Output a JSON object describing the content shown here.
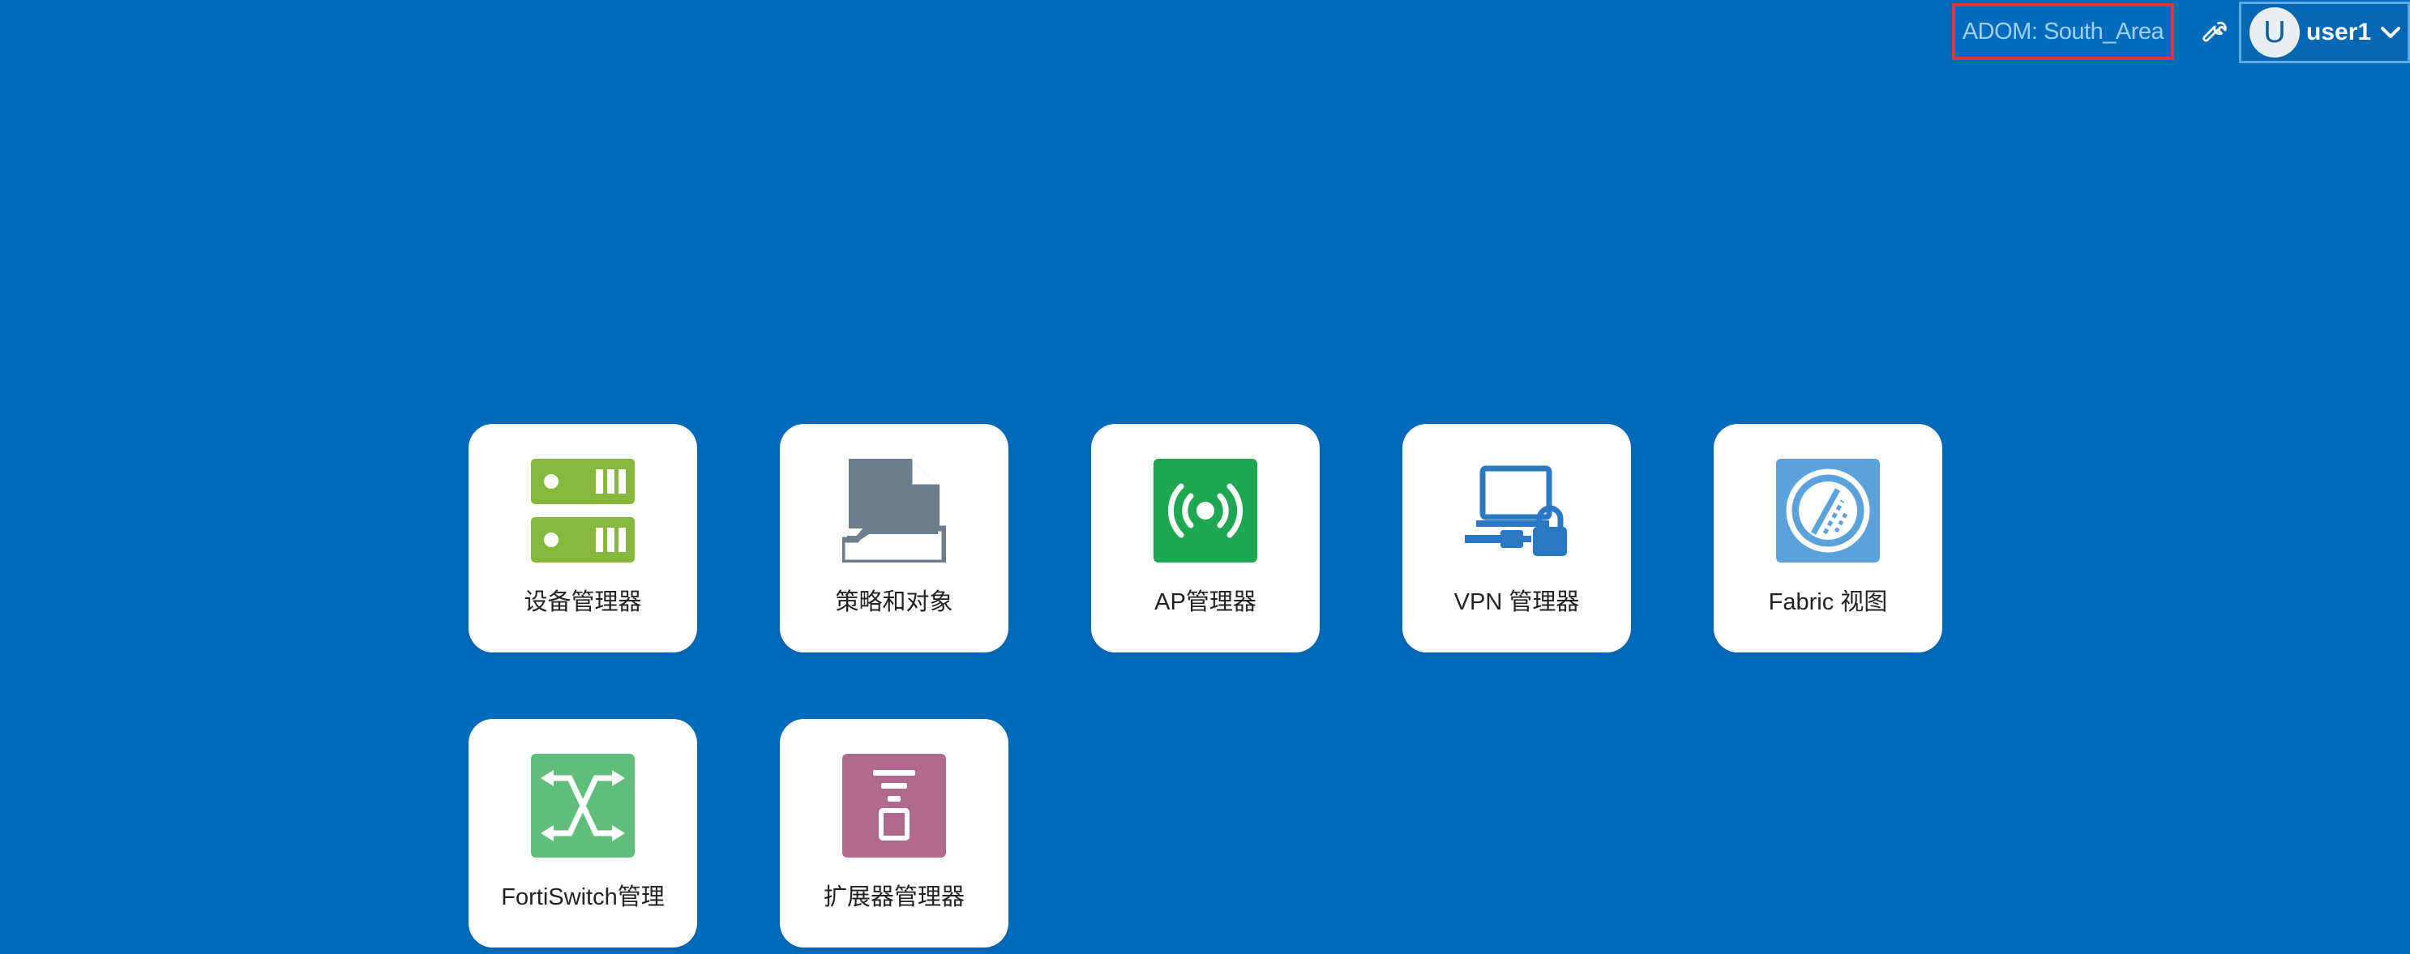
{
  "header": {
    "adom_label": "ADOM: South_Area",
    "tools_icon": "wrench-icon",
    "user": {
      "avatar_letter": "U",
      "name": "user1",
      "dropdown_icon": "chevron-down-icon"
    }
  },
  "tiles": [
    {
      "label": "设备管理器",
      "icon": "device-manager-icon",
      "color": "#86b83e"
    },
    {
      "label": "策略和对象",
      "icon": "policy-objects-icon",
      "color": "#6c7d8e"
    },
    {
      "label": "AP管理器",
      "icon": "ap-manager-icon",
      "color": "#1fa652"
    },
    {
      "label": "VPN 管理器",
      "icon": "vpn-manager-icon",
      "color": "#2b79c2"
    },
    {
      "label": "Fabric 视图",
      "icon": "fabric-view-icon",
      "color": "#5ba2dc"
    },
    {
      "label": "FortiSwitch管理",
      "icon": "fortiswitch-icon",
      "color": "#5fbf7a"
    },
    {
      "label": "扩展器管理器",
      "icon": "extender-manager-icon",
      "color": "#b06a8e"
    }
  ],
  "colors": {
    "background": "#036bbb",
    "highlight_border": "#e0343f"
  }
}
